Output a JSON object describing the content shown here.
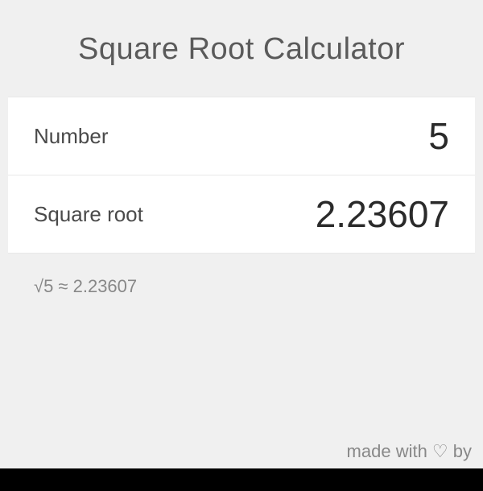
{
  "title": "Square Root Calculator",
  "rows": {
    "number": {
      "label": "Number",
      "value": "5"
    },
    "result": {
      "label": "Square root",
      "value": "2.23607"
    }
  },
  "summary": "√5 ≈ 2.23607",
  "footer": "made with ♡ by"
}
